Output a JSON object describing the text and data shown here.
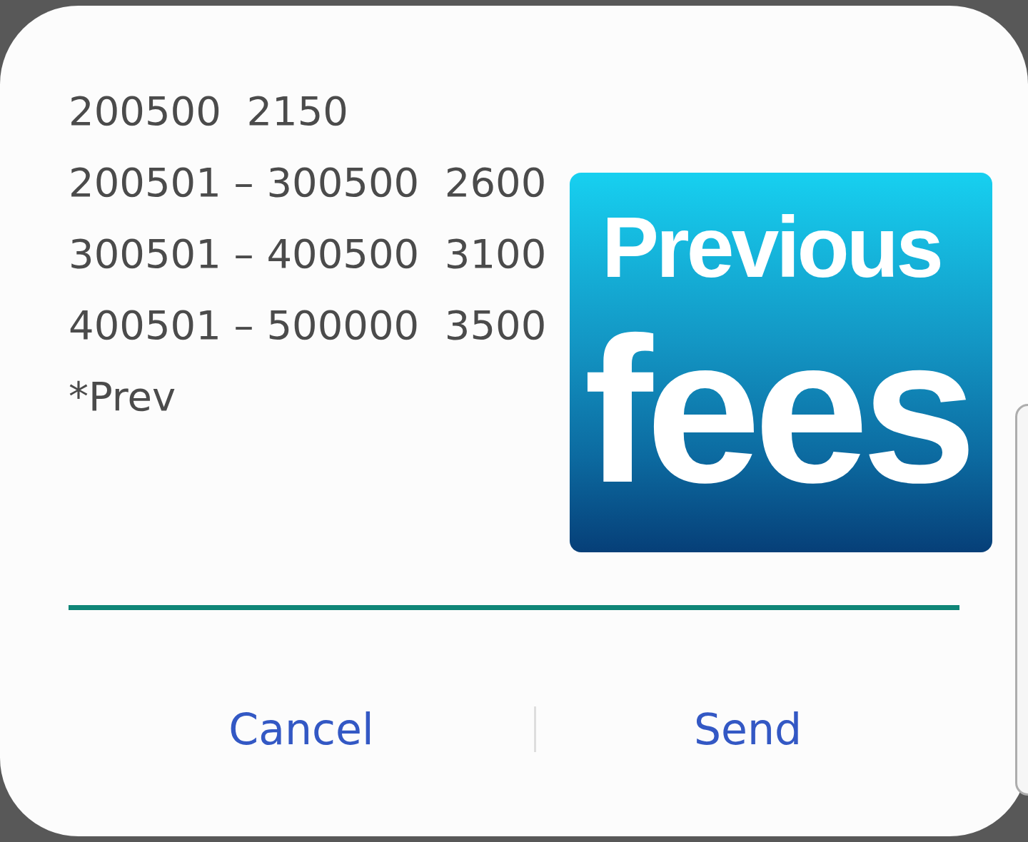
{
  "dialog": {
    "message_field": {
      "focused": true,
      "lines": [
        "200500  2150",
        "200501 – 300500  2600",
        "300501 – 400500  3100",
        "400501 – 500000  3500",
        "*Prev"
      ]
    },
    "attached_image": {
      "title": "Previous",
      "headline": "fees"
    },
    "buttons": [
      {
        "label": "Cancel"
      },
      {
        "label": "Send"
      }
    ]
  }
}
